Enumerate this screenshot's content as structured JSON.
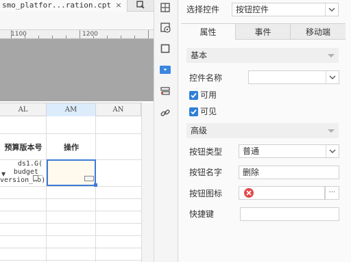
{
  "tab": {
    "title": "smo_platfor...ration.cpt",
    "close": "×"
  },
  "ruler": {
    "marks": [
      "1100",
      "1200"
    ]
  },
  "grid": {
    "columns": [
      "AL",
      "AM",
      "AN"
    ],
    "header_cells": {
      "budget_version_no": "预算版本号",
      "operation": "操作"
    },
    "formula_lines": [
      "ds1.G(",
      "budget_",
      "version_no)"
    ]
  },
  "panel": {
    "select_widget_label": "选择控件",
    "select_widget_value": "按钮控件",
    "tabs": [
      "属性",
      "事件",
      "移动端"
    ],
    "active_tab": "属性",
    "section_basic": "基本",
    "widget_name_label": "控件名称",
    "widget_name_value": "",
    "enabled_label": "可用",
    "visible_label": "可见",
    "section_advanced": "高级",
    "button_type_label": "按钮类型",
    "button_type_value": "普通",
    "button_name_label": "按钮名字",
    "button_name_value": "删除",
    "button_icon_label": "按钮图标",
    "button_icon_more": "···",
    "shortcut_label": "快捷键",
    "shortcut_value": ""
  },
  "colors": {
    "accent": "#3c7ad6",
    "checkbox": "#2f7fd6",
    "icon_error": "#e04a4a",
    "highlight_icon": "#3b86e0"
  }
}
